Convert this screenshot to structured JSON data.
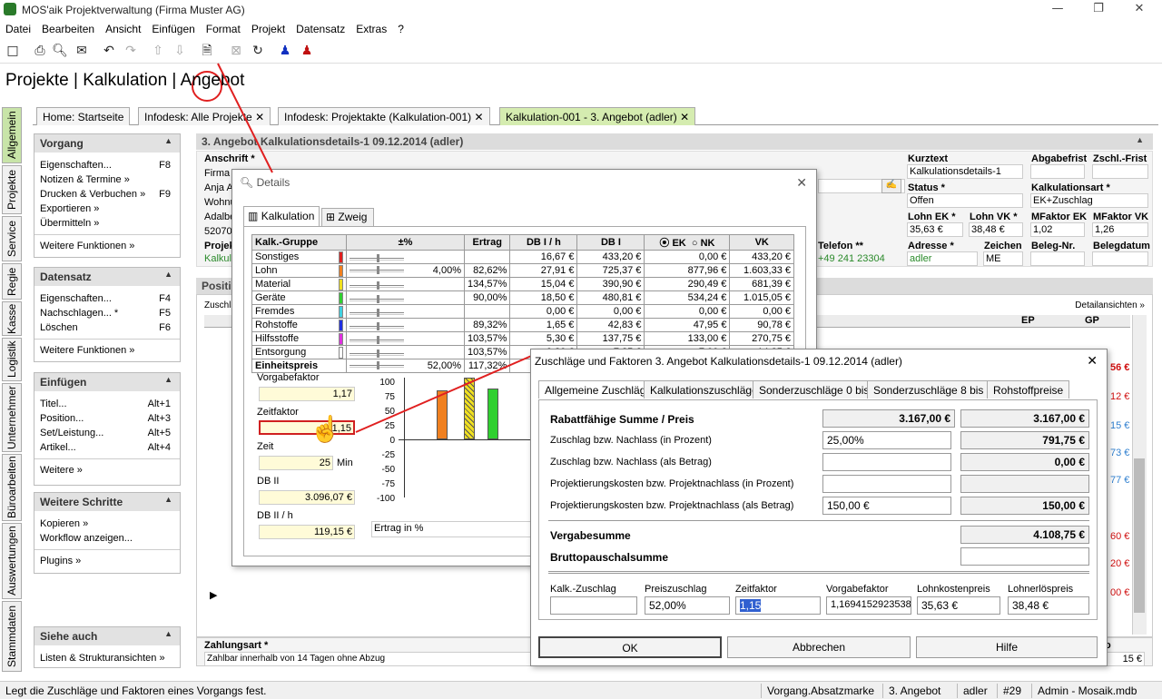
{
  "window": {
    "title": "MOS'aik Projektverwaltung (Firma Muster AG)"
  },
  "menu": [
    "Datei",
    "Bearbeiten",
    "Ansicht",
    "Einfügen",
    "Format",
    "Projekt",
    "Datensatz",
    "Extras",
    "?"
  ],
  "breadcrumb": "Projekte | Kalkulation | Angebot",
  "vtabs": [
    "Allgemein",
    "Projekte",
    "Service",
    "Regie",
    "Kasse",
    "Logistik",
    "Unternehmer",
    "Büroarbeiten",
    "Auswertungen",
    "Stammdaten"
  ],
  "doctabs": [
    "Home: Startseite",
    "Infodesk: Alle Projekte",
    "Infodesk: Projektakte (Kalkulation-001)",
    "Kalkulation-001 - 3. Angebot (adler)"
  ],
  "panels": {
    "vorgang": {
      "title": "Vorgang",
      "items": [
        {
          "label": "Eigenschaften...",
          "key": "F8"
        },
        {
          "label": "Notizen & Termine »",
          "key": ""
        },
        {
          "label": "Drucken & Verbuchen »",
          "key": "F9"
        },
        {
          "label": "Exportieren »",
          "key": ""
        },
        {
          "label": "Übermitteln »",
          "key": ""
        }
      ],
      "more": "Weitere Funktionen »"
    },
    "datensatz": {
      "title": "Datensatz",
      "items": [
        {
          "label": "Eigenschaften...",
          "key": "F4"
        },
        {
          "label": "Nachschlagen... *",
          "key": "F5"
        },
        {
          "label": "Löschen",
          "key": "F6"
        }
      ],
      "more": "Weitere Funktionen »"
    },
    "einfuegen": {
      "title": "Einfügen",
      "items": [
        {
          "label": "Titel...",
          "key": "Alt+1"
        },
        {
          "label": "Position...",
          "key": "Alt+3"
        },
        {
          "label": "Set/Leistung...",
          "key": "Alt+5"
        },
        {
          "label": "Artikel...",
          "key": "Alt+4"
        }
      ],
      "more": "Weitere »"
    },
    "schritte": {
      "title": "Weitere Schritte",
      "items": [
        {
          "label": "Kopieren »",
          "key": ""
        },
        {
          "label": "Workflow anzeigen...",
          "key": ""
        }
      ],
      "more": "Plugins »"
    },
    "siehe": {
      "title": "Siehe auch",
      "more": "Listen & Strukturansichten »"
    }
  },
  "header": {
    "title": "3. Angebot Kalkulationsdetails-1 09.12.2014 (adler)",
    "anschrift_label": "Anschrift *",
    "anschrift": [
      "Firma",
      "Anja A",
      "Wohnu",
      "Adalbe",
      "52070"
    ],
    "projekt_label": "Projek",
    "projekt_value": "Kalkula",
    "telefon_label": "Telefon **",
    "telefon_value": "+49 241 23304",
    "kurztext_label": "Kurztext",
    "kurztext": "Kalkulationsdetails-1",
    "abgabefrist_label": "Abgabefrist",
    "zschl_label": "Zschl.-Frist",
    "status_label": "Status *",
    "status": "Offen",
    "kalkart_label": "Kalkulationsart *",
    "kalkart": "EK+Zuschlag",
    "lohnek_label": "Lohn EK *",
    "lohnek": "35,63 €",
    "lohnvk_label": "Lohn VK *",
    "lohnvk": "38,48 €",
    "mfek_label": "MFaktor EK",
    "mfek": "1,02",
    "mfvk_label": "MFaktor VK",
    "mfvk": "1,26",
    "adresse_label": "Adresse *",
    "adresse": "adler",
    "zeichen_label": "Zeichen",
    "zeichen": "ME",
    "belegnr_label": "Beleg-Nr.",
    "belegdatum_label": "Belegdatum"
  },
  "positions": {
    "title": "Positi",
    "detail": "Detailansichten »",
    "zuschlag_short": "Zuschläg",
    "ep": "EP",
    "gp": "GP",
    "right_values": [
      "56 €",
      "12 €",
      "15 €",
      "73 €",
      "77 €",
      "60 €",
      "20 €",
      "00 €"
    ]
  },
  "zahlung": {
    "label": "Zahlungsart *",
    "value": "Zahlbar innerhalb von 14 Tagen ohne Abzug",
    "right": "o",
    "right_value": "15 €"
  },
  "details": {
    "title": "Details",
    "tabs": [
      "Kalkulation",
      "Zweig"
    ],
    "columns": [
      "Kalk.-Gruppe",
      "±%",
      "Ertrag",
      "DB I / h",
      "DB I",
      "EK",
      "NK",
      "VK"
    ],
    "rows": [
      {
        "name": "Sonstiges",
        "color": "#e02020",
        "pct": "",
        "ertrag": "",
        "dbih": "16,67 €",
        "dbi": "433,20 €",
        "ek": "0,00 €",
        "vk": "433,20 €"
      },
      {
        "name": "Lohn",
        "color": "#f08020",
        "pct": "4,00%",
        "ertrag": "82,62%",
        "dbih": "27,91 €",
        "dbi": "725,37 €",
        "ek": "877,96 €",
        "vk": "1.603,33 €"
      },
      {
        "name": "Material",
        "color": "#f0e020",
        "pct": "",
        "ertrag": "134,57%",
        "dbih": "15,04 €",
        "dbi": "390,90 €",
        "ek": "290,49 €",
        "vk": "681,39 €"
      },
      {
        "name": "Geräte",
        "color": "#30d030",
        "pct": "",
        "ertrag": "90,00%",
        "dbih": "18,50 €",
        "dbi": "480,81 €",
        "ek": "534,24 €",
        "vk": "1.015,05 €"
      },
      {
        "name": "Fremdes",
        "color": "#40d0e0",
        "pct": "",
        "ertrag": "",
        "dbih": "0,00 €",
        "dbi": "0,00 €",
        "ek": "0,00 €",
        "vk": "0,00 €"
      },
      {
        "name": "Rohstoffe",
        "color": "#2030e0",
        "pct": "",
        "ertrag": "89,32%",
        "dbih": "1,65 €",
        "dbi": "42,83 €",
        "ek": "47,95 €",
        "vk": "90,78 €"
      },
      {
        "name": "Hilfsstoffe",
        "color": "#e030e0",
        "pct": "",
        "ertrag": "103,57%",
        "dbih": "5,30 €",
        "dbi": "137,75 €",
        "ek": "133,00 €",
        "vk": "270,75 €"
      },
      {
        "name": "Entsorgung",
        "color": "#ffffff",
        "pct": "",
        "ertrag": "103,57%",
        "dbih": "0,20 €",
        "dbi": "7,25 €",
        "ek": "7,00 €",
        "vk": "14,25 €"
      }
    ],
    "total": {
      "name": "Einheitspreis",
      "pct": "52,00%",
      "ertrag": "117,32%"
    },
    "vorgabefaktor_label": "Vorgabefaktor",
    "vorgabefaktor": "1,17",
    "zeitfaktor_label": "Zeitfaktor",
    "zeitfaktor": "1,15",
    "zeit_label": "Zeit",
    "zeit": "25",
    "zeit_unit": "Min",
    "db2_label": "DB II",
    "db2": "3.096,07 €",
    "db2h_label": "DB II / h",
    "db2h": "119,15 €",
    "chart_axis": [
      "100",
      "75",
      "50",
      "25",
      "0",
      "-25",
      "-50",
      "-75",
      "-100"
    ],
    "chart_caption": "Ertrag in %"
  },
  "zuschlaege": {
    "title": "Zuschläge und Faktoren 3. Angebot Kalkulationsdetails-1 09.12.2014 (adler)",
    "tabs": [
      "Allgemeine Zuschläge",
      "Kalkulationszuschläge",
      "Sonderzuschläge 0 bis 7",
      "Sonderzuschläge 8 bis 15",
      "Rohstoffpreise"
    ],
    "rows": [
      {
        "label": "Rabattfähige Summe / Preis",
        "in": "3.167,00 €",
        "out": "3.167,00 €",
        "bold": true
      },
      {
        "label": "Zuschlag bzw. Nachlass (in Prozent)",
        "in": "25,00%",
        "out": "791,75 €"
      },
      {
        "label": "Zuschlag bzw. Nachlass (als Betrag)",
        "in": "",
        "out": "0,00 €"
      },
      {
        "label": "Projektierungskosten bzw. Projektnachlass (in Prozent)",
        "in": "",
        "out": ""
      },
      {
        "label": "Projektierungskosten bzw. Projektnachlass (als Betrag)",
        "in": "150,00 €",
        "out": "150,00 €"
      }
    ],
    "vergabe_label": "Vergabesumme",
    "vergabe": "4.108,75 €",
    "brutto_label": "Bruttopauschalsumme",
    "brutto": "",
    "bottom_labels": [
      "Kalk.-Zuschlag",
      "Preiszuschlag",
      "Zeitfaktor",
      "Vorgabefaktor",
      "Lohnkostenpreis",
      "Lohnerlöspreis"
    ],
    "bottom_values": [
      "",
      "52,00%",
      "1,15",
      "1,1694152923538",
      "35,63 €",
      "38,48 €"
    ],
    "ok": "OK",
    "cancel": "Abbrechen",
    "help": "Hilfe"
  },
  "status": {
    "text": "Legt die Zuschläge und Faktoren eines Vorgangs fest.",
    "cells": [
      "Vorgang.Absatzmarke",
      "3. Angebot",
      "adler",
      "#29",
      "Admin - Mosaik.mdb"
    ]
  }
}
